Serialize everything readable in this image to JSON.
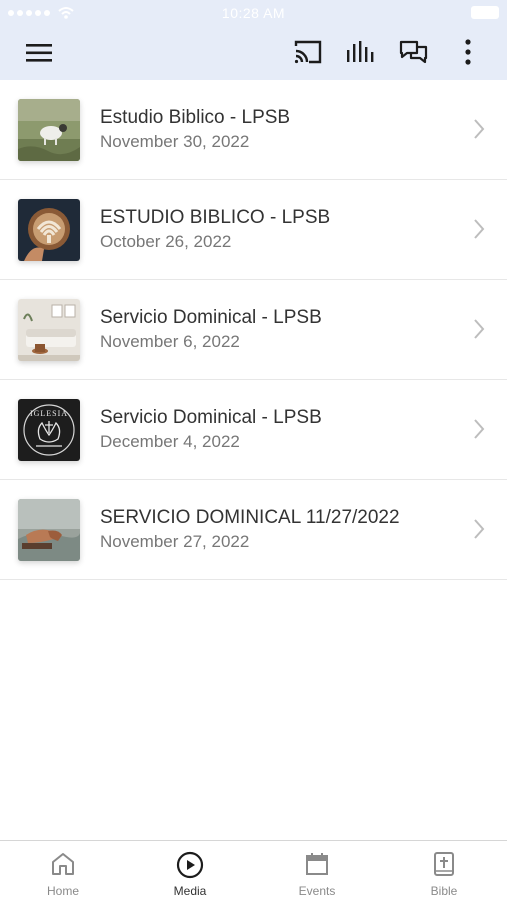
{
  "status_bar": {
    "time": "10:28 AM"
  },
  "app_bar": {
    "menu_icon": "hamburger-menu-icon",
    "actions": [
      "cast-icon",
      "equalizer-icon",
      "chat-icon",
      "more-vertical-icon"
    ]
  },
  "media_list": [
    {
      "title": "Estudio Biblico - LPSB",
      "date": "November 30, 2022",
      "thumbnail": "sheep-in-field"
    },
    {
      "title": "ESTUDIO BIBLICO - LPSB",
      "date": "October 26, 2022",
      "thumbnail": "latte-art-coffee"
    },
    {
      "title": "Servicio Dominical - LPSB",
      "date": "November 6, 2022",
      "thumbnail": "living-room"
    },
    {
      "title": "Servicio Dominical - LPSB",
      "date": "December 4, 2022",
      "thumbnail": "church-logo"
    },
    {
      "title": "SERVICIO DOMINICAL 11/27/2022",
      "date": "November 27, 2022",
      "thumbnail": "praying-hands"
    }
  ],
  "thumbnail_logo_text": "IGLESIA",
  "tab_bar": {
    "tabs": [
      {
        "label": "Home",
        "icon": "home-icon"
      },
      {
        "label": "Media",
        "icon": "play-circle-icon",
        "active": true
      },
      {
        "label": "Events",
        "icon": "calendar-icon"
      },
      {
        "label": "Bible",
        "icon": "bible-icon"
      }
    ]
  },
  "colors": {
    "app_bar_bg": "#e6ecf8",
    "icon": "#1c1c1c",
    "chevron": "#bdbdbd",
    "inactive_tab": "#8a8a8a"
  }
}
